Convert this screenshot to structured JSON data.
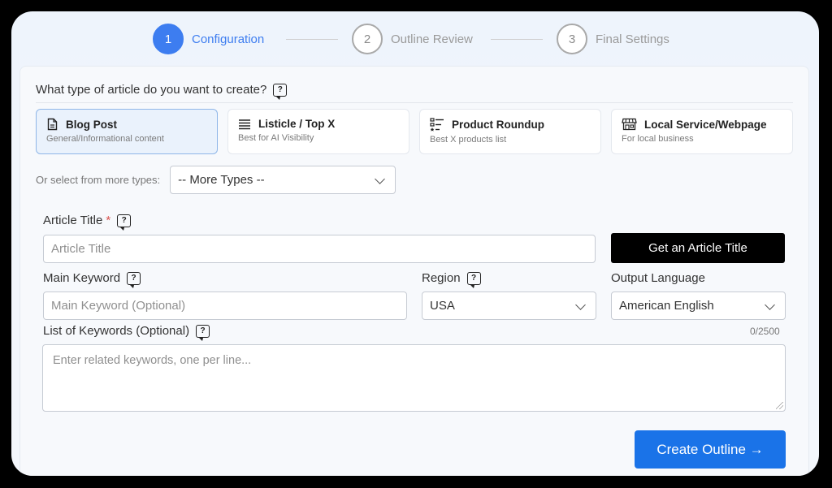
{
  "stepper": {
    "steps": [
      {
        "number": "1",
        "label": "Configuration",
        "active": true
      },
      {
        "number": "2",
        "label": "Outline Review",
        "active": false
      },
      {
        "number": "3",
        "label": "Final Settings",
        "active": false
      }
    ]
  },
  "article_type": {
    "question": "What type of article do you want to create?",
    "help_icon": "question-icon",
    "cards": [
      {
        "icon": "document-icon",
        "title": "Blog Post",
        "subtitle": "General/Informational content",
        "selected": true
      },
      {
        "icon": "list-icon",
        "title": "Listicle / Top X",
        "subtitle": "Best for AI Visibility",
        "selected": false
      },
      {
        "icon": "ranked-list-icon",
        "title": "Product Roundup",
        "subtitle": "Best X products list",
        "selected": false
      },
      {
        "icon": "storefront-icon",
        "title": "Local Service/Webpage",
        "subtitle": "For local business",
        "selected": false
      }
    ],
    "more_label": "Or select from more types:",
    "more_select": "-- More Types --"
  },
  "form": {
    "title_label": "Article Title",
    "title_required": "*",
    "title_placeholder": "Article Title",
    "get_title_button": "Get an Article Title",
    "keyword_label": "Main Keyword",
    "keyword_placeholder": "Main Keyword (Optional)",
    "region_label": "Region",
    "region_value": "USA",
    "language_label": "Output Language",
    "language_value": "American English",
    "keywords_list_label": "List of Keywords (Optional)",
    "keywords_counter": "0/2500",
    "keywords_placeholder": "Enter related keywords, one per line..."
  },
  "actions": {
    "create_outline": "Create Outline →"
  },
  "colors": {
    "accent": "#1a73e8",
    "step_active": "#3d7df0",
    "selected_card_bg": "#eaf2fc"
  }
}
